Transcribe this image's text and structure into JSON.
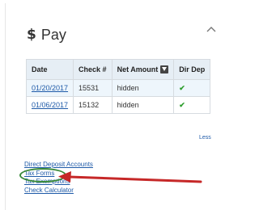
{
  "header": {
    "icon": "dollar-icon",
    "title": "Pay",
    "collapse_icon": "chevron-up-icon"
  },
  "table": {
    "columns": [
      "Date",
      "Check #",
      "Net Amount",
      "Dir Dep"
    ],
    "rows": [
      {
        "date": "01/20/2017",
        "check": "15531",
        "amount": "hidden",
        "dir_dep": "✔"
      },
      {
        "date": "01/06/2017",
        "check": "15132",
        "amount": "hidden",
        "dir_dep": "✔"
      }
    ]
  },
  "less_label": "Less",
  "links": [
    "Direct Deposit Accounts",
    "Tax Forms",
    "Tax Exemptions",
    "Check Calculator"
  ],
  "annotation": {
    "ellipse_color": "#3a8a3a",
    "arrow_color": "#c62828"
  },
  "colors": {
    "link": "#1e5aa8",
    "header_bg": "#e6eef5",
    "check": "#2e9e2e"
  }
}
